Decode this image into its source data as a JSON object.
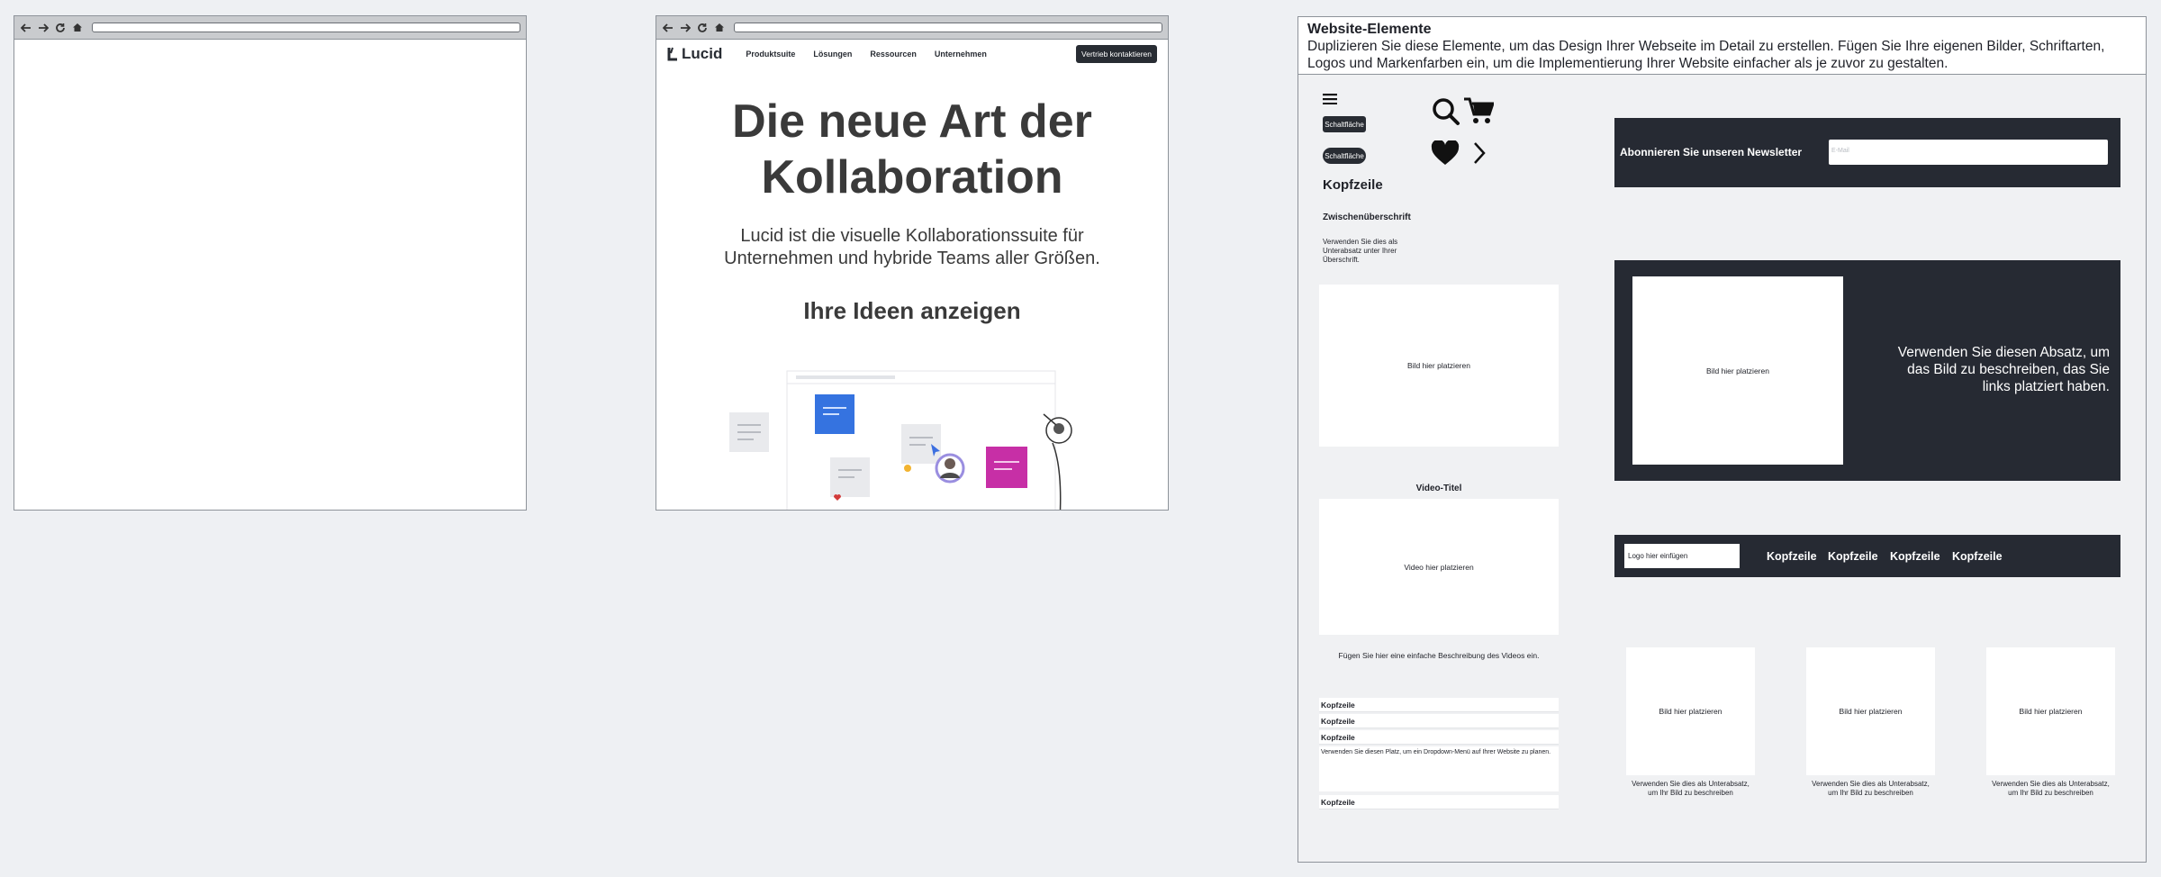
{
  "site": {
    "logo": "Lucid",
    "nav": [
      "Produktsuite",
      "Lösungen",
      "Ressourcen",
      "Unternehmen"
    ],
    "cta": "Vertrieb kontaktieren",
    "hero_title_1": "Die neue Art der",
    "hero_title_2": "Kollaboration",
    "hero_text": "Lucid ist die visuelle Kollaborationssuite für Unternehmen und hybride Teams aller Größen.",
    "hero_subtitle": "Ihre Ideen anzeigen"
  },
  "panel": {
    "title": "Website-Elemente",
    "description": "Duplizieren Sie diese Elemente, um das Design Ihrer Webseite im Detail zu erstellen. Fügen Sie Ihre eigenen Bilder, Schriftarten, Logos und Markenfarben ein, um die Implementierung Ihrer Website einfacher als je zuvor zu gestalten.",
    "button_1": "Schaltfläche",
    "button_2": "Schaltfläche",
    "header": "Kopfzeile",
    "subheader": "Zwischenüberschrift",
    "subheader_text": "Verwenden Sie dies als Unterabsatz unter Ihrer Überschrift.",
    "image_placeholder": "Bild hier platzieren",
    "video_title": "Video-Titel",
    "video_placeholder": "Video hier platzieren",
    "video_description": "Fügen Sie hier eine einfache Beschreibung des Videos ein.",
    "accordion": [
      "Kopfzeile",
      "Kopfzeile",
      "Kopfzeile",
      "Kopfzeile"
    ],
    "accordion_text": "Verwenden Sie diesen Platz, um ein Dropdown-Menü auf Ihrer Website zu planen.",
    "newsletter_label": "Abonnieren Sie unseren Newsletter",
    "newsletter_placeholder": "E-Mail",
    "feature_image": "Bild hier platzieren",
    "feature_text": "Verwenden Sie diesen Absatz, um das Bild zu beschreiben, das Sie links platziert haben.",
    "logo_placeholder": "Logo hier einfügen",
    "menu": [
      "Kopfzeile",
      "Kopfzeile",
      "Kopfzeile",
      "Kopfzeile"
    ],
    "cards": [
      {
        "image": "Bild hier platzieren",
        "caption": "Verwenden Sie dies als Unterabsatz, um Ihr Bild zu beschreiben"
      },
      {
        "image": "Bild hier platzieren",
        "caption": "Verwenden Sie dies als Unterabsatz, um Ihr Bild zu beschreiben"
      },
      {
        "image": "Bild hier platzieren",
        "caption": "Verwenden Sie dies als Unterabsatz, um Ihr Bild zu beschreiben"
      }
    ]
  },
  "colors": {
    "dark": "#262a33",
    "blue": "#3573e0",
    "magenta": "#c72fa6",
    "background": "#eef0f3"
  }
}
